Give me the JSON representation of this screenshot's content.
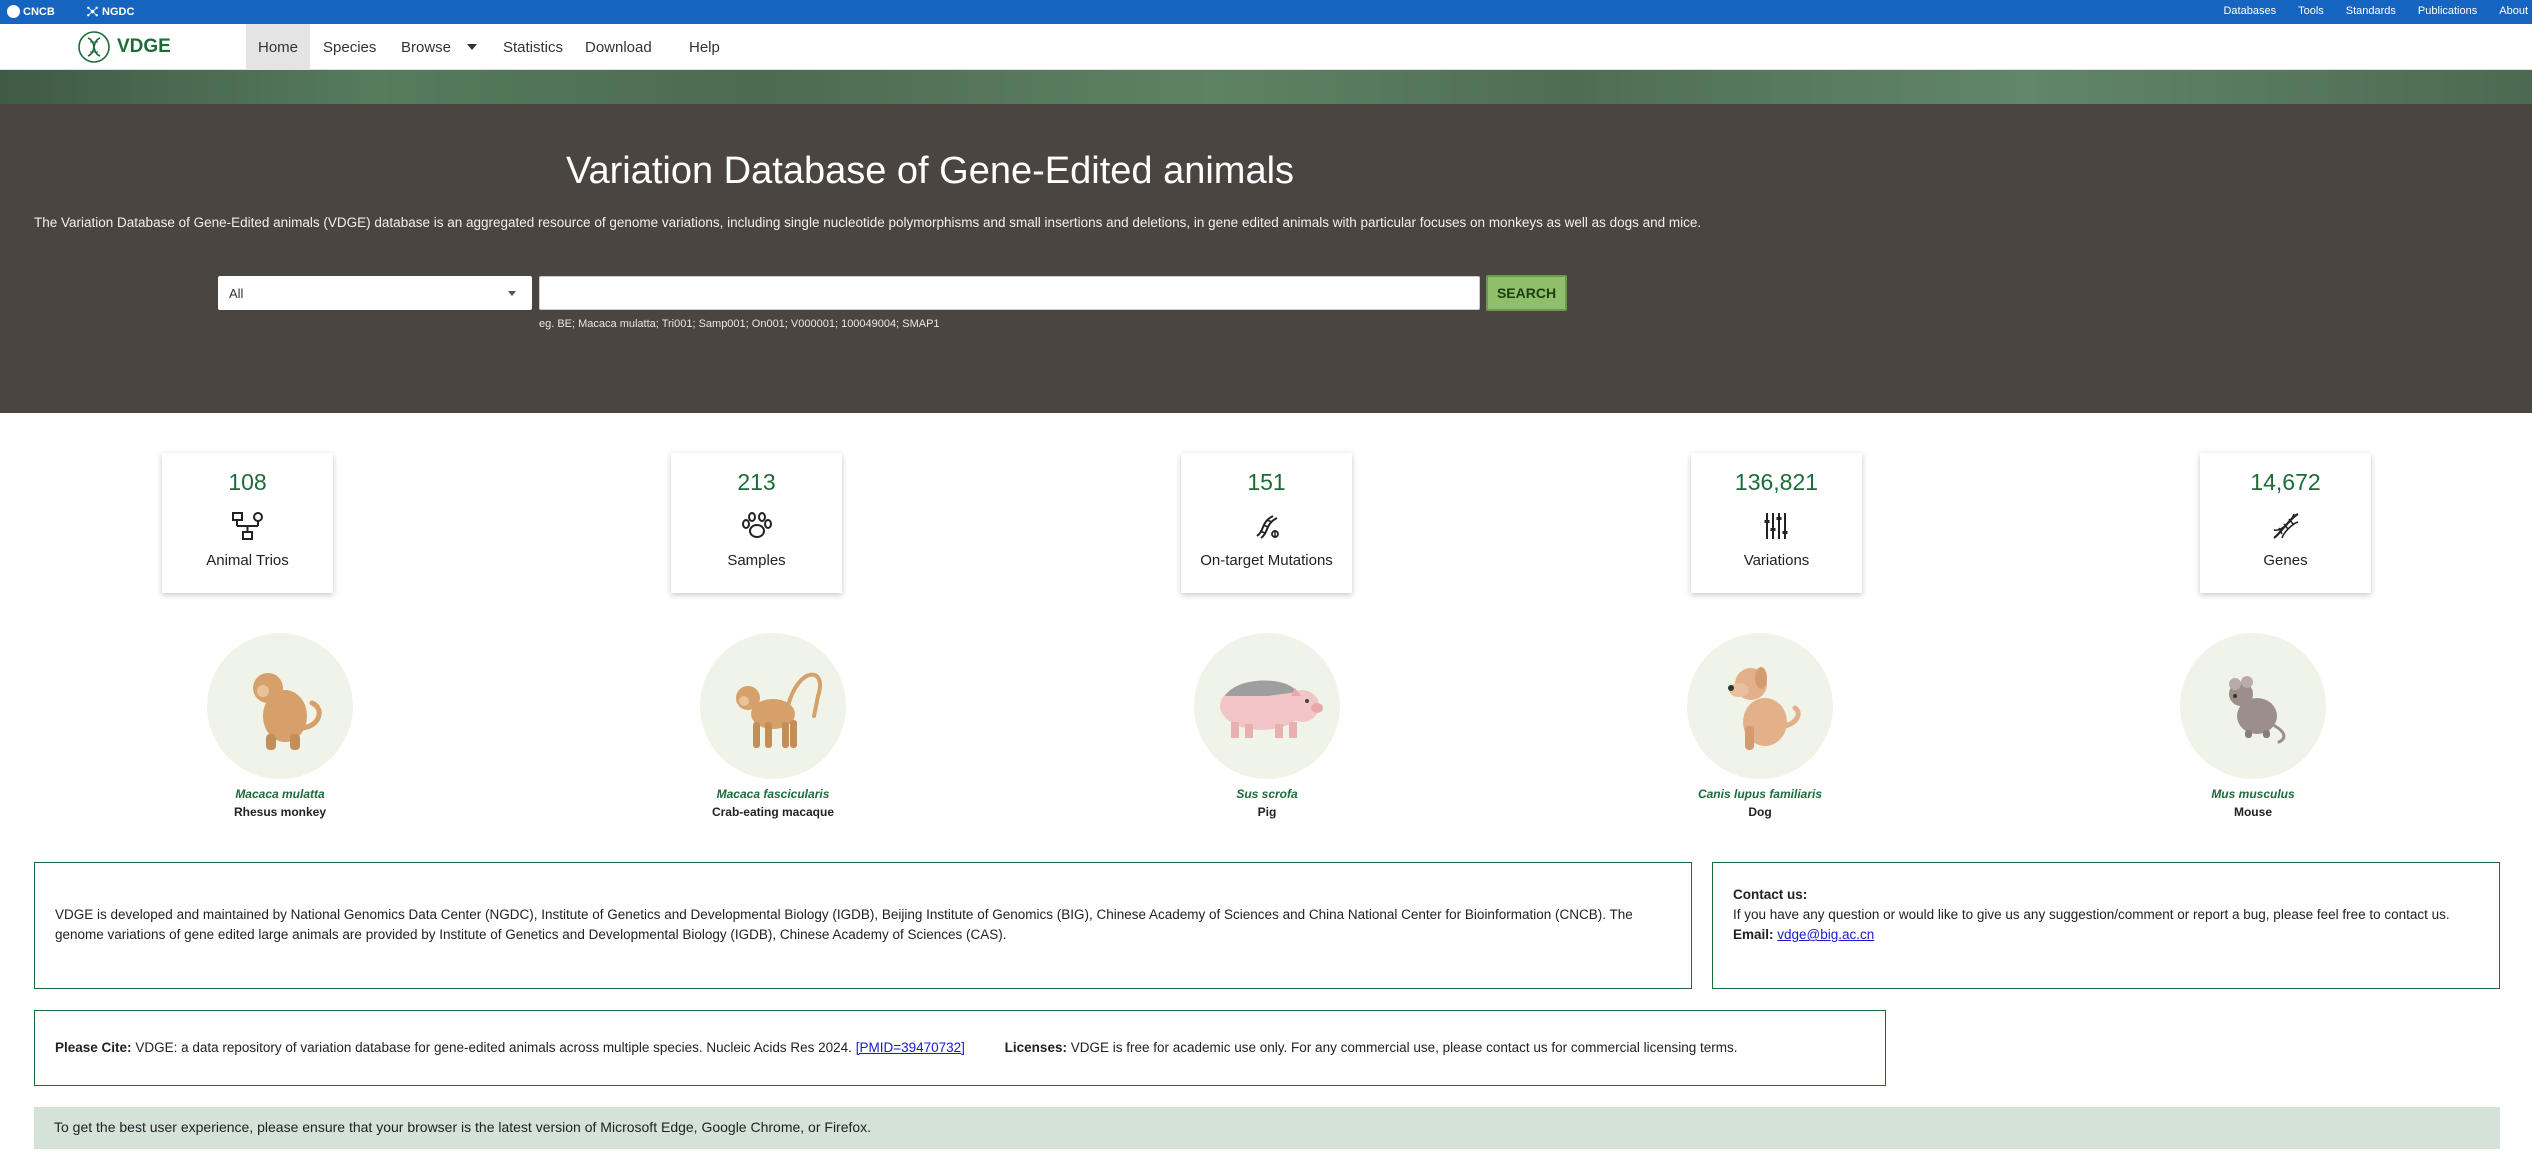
{
  "topbar": {
    "cncb": "CNCB",
    "ngdc": "NGDC",
    "links": [
      "Databases",
      "Tools",
      "Standards",
      "Publications",
      "About"
    ]
  },
  "nav": {
    "site_name": "VDGE",
    "items": [
      "Home",
      "Species",
      "Browse",
      "Statistics",
      "Download",
      "Help"
    ]
  },
  "hero": {
    "title": "Variation Database of Gene-Edited animals",
    "description": "The Variation Database of Gene-Edited animals (VDGE) database is an aggregated resource of genome variations, including single nucleotide polymorphisms and small insertions and deletions, in gene edited animals with particular focuses on monkeys as well as dogs and mice.",
    "select_value": "All",
    "search_value": "",
    "search_button": "SEARCH",
    "hint": "eg. BE; Macaca mulatta; Tri001; Samp001; On001; V000001; 100049004; SMAP1"
  },
  "stats": [
    {
      "value": "108",
      "label": "Animal Trios",
      "icon": "trio-icon"
    },
    {
      "value": "213",
      "label": "Samples",
      "icon": "paw-icon"
    },
    {
      "value": "151",
      "label": "On-target Mutations",
      "icon": "mutation-icon"
    },
    {
      "value": "136,821",
      "label": "Variations",
      "icon": "variations-icon"
    },
    {
      "value": "14,672",
      "label": "Genes",
      "icon": "dna-icon"
    }
  ],
  "species": [
    {
      "scientific": "Macaca mulatta",
      "common": "Rhesus monkey",
      "icon": "monkey-icon"
    },
    {
      "scientific": "Macaca fascicularis",
      "common": "Crab-eating macaque",
      "icon": "macaque-icon"
    },
    {
      "scientific": "Sus scrofa",
      "common": "Pig",
      "icon": "pig-icon"
    },
    {
      "scientific": "Canis lupus familiaris",
      "common": "Dog",
      "icon": "dog-icon"
    },
    {
      "scientific": "Mus musculus",
      "common": "Mouse",
      "icon": "mouse-icon"
    }
  ],
  "about": {
    "text": "VDGE is developed and maintained by National Genomics Data Center (NGDC), Institute of Genetics and Developmental Biology (IGDB), Beijing Institute of Genomics (BIG), Chinese Academy of Sciences and China National Center for Bioinformation (CNCB). The genome variations of gene edited large animals are provided by Institute of Genetics and Developmental Biology (IGDB), Chinese Academy of Sciences (CAS)."
  },
  "contact": {
    "heading": "Contact us:",
    "text": "If you have any question or would like to give us any suggestion/comment or report a bug, please feel free to contact us.",
    "email_label": "Email:",
    "email": "vdge@big.ac.cn"
  },
  "cite": {
    "label": "Please Cite:",
    "text": "VDGE: a data repository of variation database for gene-edited animals across multiple species. Nucleic Acids Res 2024.",
    "pmid": "[PMID=39470732]",
    "license_label": "Licenses:",
    "license_text": "VDGE is free for academic use only. For any commercial use, please contact us for commercial licensing terms."
  },
  "notice": "To get the best user experience, please ensure that your browser is the latest version of Microsoft Edge, Google Chrome, or Firefox.",
  "colors": {
    "topbar": "#1565c0",
    "hero": "#4a4540",
    "accent_green": "#1e6b3a",
    "search_button": "#8fbf6a",
    "notice_bg": "#d4e2d8"
  }
}
